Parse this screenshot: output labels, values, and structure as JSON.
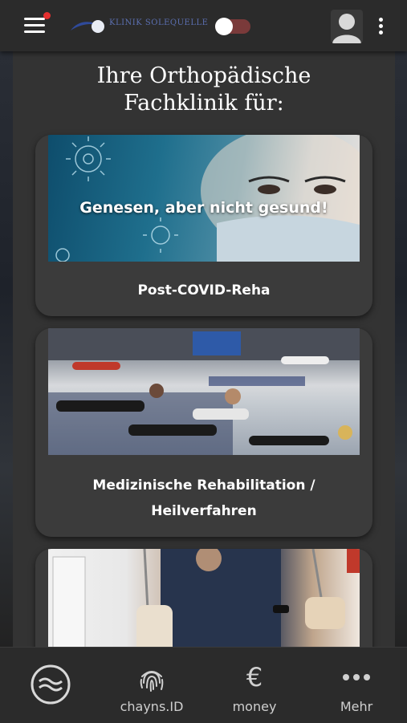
{
  "header": {
    "menu_icon": "hamburger-icon",
    "notification": true,
    "logo_text": "KLINIK SOLEQUELLE",
    "dark_mode_toggle": "on",
    "avatar_icon": "user-avatar-icon",
    "more_icon": "kebab-menu-icon"
  },
  "main": {
    "title_line1": "Ihre Orthopädische",
    "title_line2": "Fachklinik für:",
    "cards": [
      {
        "image_caption": "Genesen, aber nicht gesund!",
        "label": "Post-COVID-Reha"
      },
      {
        "label_line1": "Medizinische Rehabilitation /",
        "label_line2": "Heilverfahren"
      },
      {
        "label": ""
      }
    ]
  },
  "bottom_nav": [
    {
      "icon": "chayns-logo-icon",
      "label": ""
    },
    {
      "icon": "fingerprint-icon",
      "label": "chayns.ID"
    },
    {
      "icon": "euro-icon",
      "label": "money"
    },
    {
      "icon": "more-dots-icon",
      "label": "Mehr"
    }
  ],
  "colors": {
    "header_bg": "#2b2b2b",
    "content_bg": "#333333",
    "card_bg": "#3b3b3b",
    "notification_dot": "#e53030",
    "logo_blue": "#5b6fb0"
  }
}
